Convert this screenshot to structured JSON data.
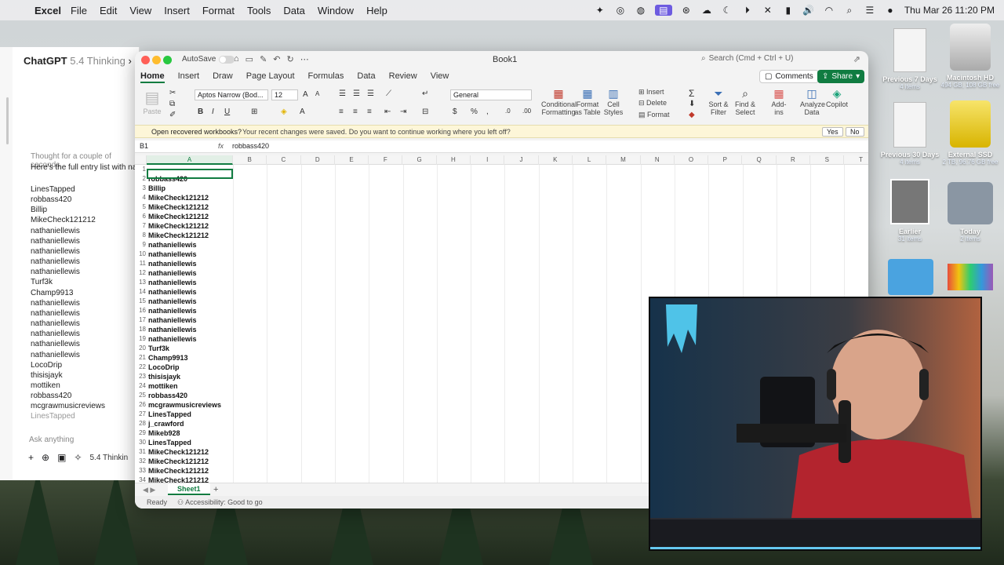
{
  "menubar": {
    "app": "Excel",
    "items": [
      "File",
      "Edit",
      "View",
      "Insert",
      "Format",
      "Tools",
      "Data",
      "Window",
      "Help"
    ],
    "datetime": "Thu Mar 26  11:20 PM"
  },
  "chatgpt": {
    "title": "ChatGPT",
    "model_title": "5.4 Thinking",
    "thought": "Thought for a couple of seconds",
    "intro": "Here's the full entry list with names",
    "names": [
      "LinesTapped",
      "robbass420",
      "Billip",
      "MikeCheck121212",
      "nathaniellewis",
      "nathaniellewis",
      "nathaniellewis",
      "nathaniellewis",
      "nathaniellewis",
      "Turf3k",
      "Champ9913",
      "nathaniellewis",
      "nathaniellewis",
      "nathaniellewis",
      "nathaniellewis",
      "nathaniellewis",
      "nathaniellewis",
      "LocoDrip",
      "thisisjayk",
      "mottiken",
      "robbass420",
      "mcgrawmusicreviews",
      "LinesTapped"
    ],
    "ask_placeholder": "Ask anything",
    "model_label": "5.4 Thinkin"
  },
  "excel": {
    "autosave": "AutoSave",
    "doc_title": "Book1",
    "search_placeholder": "Search (Cmd + Ctrl + U)",
    "tabs": [
      "Home",
      "Insert",
      "Draw",
      "Page Layout",
      "Formulas",
      "Data",
      "Review",
      "View"
    ],
    "active_tab": "Home",
    "comments": "Comments",
    "share": "Share",
    "ribbon": {
      "paste": "Paste",
      "font": "Aptos Narrow (Bod...",
      "size": "12",
      "number_format": "General",
      "conditional_formatting": [
        "Conditional",
        "Formatting"
      ],
      "format_as_table": [
        "Format",
        "as Table"
      ],
      "cell_styles": [
        "Cell",
        "Styles"
      ],
      "insert": "Insert",
      "delete": "Delete",
      "format": "Format",
      "sort_filter": [
        "Sort &",
        "Filter"
      ],
      "find_select": [
        "Find &",
        "Select"
      ],
      "addins": "Add-ins",
      "analyze": [
        "Analyze",
        "Data"
      ],
      "copilot": "Copilot"
    },
    "notice": {
      "question": "Open recovered workbooks?",
      "message": "Your recent changes were saved. Do you want to continue working where you left off?",
      "yes": "Yes",
      "no": "No"
    },
    "name_box": "B1",
    "formula_value": "robbass420",
    "columns": [
      "A",
      "B",
      "C",
      "D",
      "E",
      "F",
      "G",
      "H",
      "I",
      "J",
      "K",
      "L",
      "M",
      "N",
      "O",
      "P",
      "Q",
      "R",
      "S",
      "T"
    ],
    "rows": [
      "",
      "robbass420",
      "Billip",
      "MikeCheck121212",
      "MikeCheck121212",
      "MikeCheck121212",
      "MikeCheck121212",
      "MikeCheck121212",
      "nathaniellewis",
      "nathaniellewis",
      "nathaniellewis",
      "nathaniellewis",
      "nathaniellewis",
      "nathaniellewis",
      "nathaniellewis",
      "nathaniellewis",
      "nathaniellewis",
      "nathaniellewis",
      "nathaniellewis",
      "Turf3k",
      "Champ9913",
      "LocoDrip",
      "thisisjayk",
      "mottiken",
      "robbass420",
      "mcgrawmusicreviews",
      "LinesTapped",
      "j_crawford",
      "Mikeb928",
      "LinesTapped",
      "MikeCheck121212",
      "MikeCheck121212",
      "MikeCheck121212",
      "MikeCheck121212"
    ],
    "sheet": "Sheet1",
    "status_ready": "Ready",
    "status_access": "Accessibility: Good to go"
  },
  "desktop": {
    "icons": [
      {
        "label": "Previous 7 Days",
        "sub": "4 items"
      },
      {
        "label": "Macintosh HD",
        "sub": "494 GB, 108 GB free"
      },
      {
        "label": "Previous 30 Days",
        "sub": "4 items"
      },
      {
        "label": "External SSD",
        "sub": "2 TB, 96.76 GB free"
      },
      {
        "label": "Earlier",
        "sub": "31 items"
      },
      {
        "label": "Today",
        "sub": "2 items"
      }
    ]
  }
}
